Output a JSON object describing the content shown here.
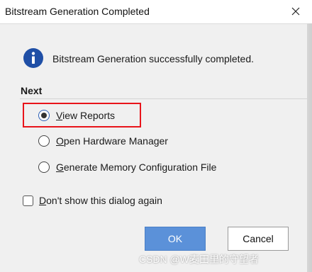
{
  "window": {
    "title": "Bitstream Generation Completed"
  },
  "message": {
    "text": "Bitstream Generation successfully completed."
  },
  "next": {
    "label": "Next",
    "options": [
      {
        "label": "View Reports",
        "accel": "V",
        "rest": "iew Reports",
        "checked": true
      },
      {
        "label": "Open Hardware Manager",
        "accel": "O",
        "rest": "pen Hardware Manager",
        "checked": false
      },
      {
        "label": "Generate Memory Configuration File",
        "accel": "G",
        "rest": "enerate Memory Configuration File",
        "checked": false
      }
    ]
  },
  "dont_show": {
    "label": "Don't show this dialog again",
    "accel": "D",
    "rest": "on't show this dialog again",
    "checked": false
  },
  "buttons": {
    "ok": "OK",
    "cancel": "Cancel"
  },
  "watermark": "CSDN @W麦田里的守望者",
  "colors": {
    "info_icon": "#1f4fa6",
    "ok_button": "#5b91d9",
    "highlight": "#e8141b"
  }
}
